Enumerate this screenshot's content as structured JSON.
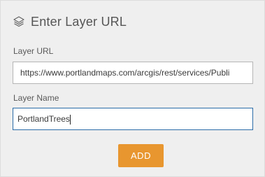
{
  "header": {
    "icon": "layers-icon",
    "title": "Enter Layer URL"
  },
  "form": {
    "url_label": "Layer URL",
    "url_value": "https://www.portlandmaps.com/arcgis/rest/services/Publi",
    "name_label": "Layer Name",
    "name_value": "PortlandTrees"
  },
  "actions": {
    "add_label": "ADD"
  },
  "colors": {
    "panel_bg": "#efefef",
    "accent_button": "#e8962f",
    "focus_border": "#2b6ca8"
  }
}
